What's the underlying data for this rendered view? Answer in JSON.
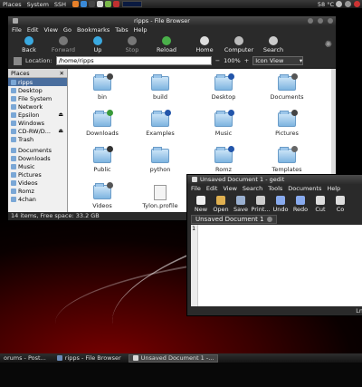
{
  "panel": {
    "menus": [
      "Places",
      "System",
      "SSH"
    ],
    "temperature": "58 °C",
    "tray_icons": [
      {
        "name": "firefox-icon",
        "color": "#e8812a"
      },
      {
        "name": "chat-icon",
        "color": "#3a8ad8"
      },
      {
        "name": "terminal-icon",
        "color": "#444444"
      },
      {
        "name": "mail-icon",
        "color": "#d8d8d8"
      },
      {
        "name": "weather-icon",
        "color": "#7ab84a"
      },
      {
        "name": "music-icon",
        "color": "#c03030"
      }
    ]
  },
  "file_browser": {
    "title": "ripps - File Browser",
    "menu": [
      "File",
      "Edit",
      "View",
      "Go",
      "Bookmarks",
      "Tabs",
      "Help"
    ],
    "toolbar": [
      {
        "label": "Back",
        "enabled": true,
        "icon": "back-arrow-icon",
        "color": "#3aa9e0"
      },
      {
        "label": "Forward",
        "enabled": false,
        "icon": "forward-arrow-icon",
        "color": "#777777"
      },
      {
        "label": "Up",
        "enabled": true,
        "icon": "up-arrow-icon",
        "color": "#3aa9e0"
      },
      {
        "label": "Stop",
        "enabled": false,
        "icon": "stop-icon",
        "color": "#777777"
      },
      {
        "label": "Reload",
        "enabled": true,
        "icon": "reload-icon",
        "color": "#4ab04a"
      },
      {
        "label": "Home",
        "enabled": true,
        "icon": "home-icon",
        "color": "#dddddd"
      },
      {
        "label": "Computer",
        "enabled": true,
        "icon": "computer-icon",
        "color": "#bbbbbb"
      },
      {
        "label": "Search",
        "enabled": true,
        "icon": "search-icon",
        "color": "#cccccc"
      }
    ],
    "location_label": "Location:",
    "location_value": "/home/ripps",
    "zoom": "100%",
    "view_mode": "Icon View",
    "places_header": "Places",
    "places": [
      {
        "label": "ripps",
        "selected": true,
        "eject": false
      },
      {
        "label": "Desktop",
        "selected": false,
        "eject": false
      },
      {
        "label": "File System",
        "selected": false,
        "eject": false
      },
      {
        "label": "Network",
        "selected": false,
        "eject": false
      },
      {
        "label": "Epsilon",
        "selected": false,
        "eject": true
      },
      {
        "label": "Windows",
        "selected": false,
        "eject": false
      },
      {
        "label": "CD-RW/D...",
        "selected": false,
        "eject": true
      },
      {
        "label": "Trash",
        "selected": false,
        "eject": false
      }
    ],
    "bookmarks": [
      "Documents",
      "Downloads",
      "Music",
      "Pictures",
      "Videos",
      "Romz",
      "4chan"
    ],
    "files": [
      {
        "name": "bin",
        "type": "folder",
        "emblem": "#444444"
      },
      {
        "name": "build",
        "type": "folder",
        "emblem": ""
      },
      {
        "name": "Desktop",
        "type": "folder",
        "emblem": "#2255aa"
      },
      {
        "name": "Documents",
        "type": "folder",
        "emblem": "#555555"
      },
      {
        "name": "Downloads",
        "type": "folder",
        "emblem": "#3a9a3a"
      },
      {
        "name": "Examples",
        "type": "folder",
        "emblem": "#2255aa"
      },
      {
        "name": "Music",
        "type": "folder",
        "emblem": "#2255aa"
      },
      {
        "name": "Pictures",
        "type": "folder",
        "emblem": "#444444"
      },
      {
        "name": "Public",
        "type": "folder",
        "emblem": "#333333"
      },
      {
        "name": "python",
        "type": "folder",
        "emblem": ""
      },
      {
        "name": "Romz",
        "type": "folder",
        "emblem": "#2255aa"
      },
      {
        "name": "Templates",
        "type": "folder",
        "emblem": "#666666"
      },
      {
        "name": "Videos",
        "type": "folder",
        "emblem": "#555555"
      },
      {
        "name": "Tylon.profile",
        "type": "file",
        "emblem": ""
      }
    ],
    "status": "14 items, Free space: 33.2 GB"
  },
  "gedit": {
    "title": "Unsaved Document 1 - gedit",
    "menu": [
      "File",
      "Edit",
      "View",
      "Search",
      "Tools",
      "Documents",
      "Help"
    ],
    "toolbar": [
      {
        "label": "New",
        "icon": "new-document-icon"
      },
      {
        "label": "Open",
        "icon": "open-folder-icon"
      },
      {
        "label": "Save",
        "icon": "save-icon"
      },
      {
        "label": "Print...",
        "icon": "print-icon"
      },
      {
        "label": "Undo",
        "icon": "undo-icon"
      },
      {
        "label": "Redo",
        "icon": "redo-icon"
      },
      {
        "label": "Cut",
        "icon": "cut-icon"
      },
      {
        "label": "Co",
        "icon": "copy-icon"
      }
    ],
    "tab_label": "Unsaved Document 1",
    "line_number": "1",
    "status": "Ln"
  },
  "taskbar": {
    "items": [
      {
        "label": "orums - Post...",
        "active": false
      },
      {
        "label": "ripps - File Browser",
        "active": false
      },
      {
        "label": "Unsaved Document 1 -...",
        "active": true
      }
    ]
  }
}
